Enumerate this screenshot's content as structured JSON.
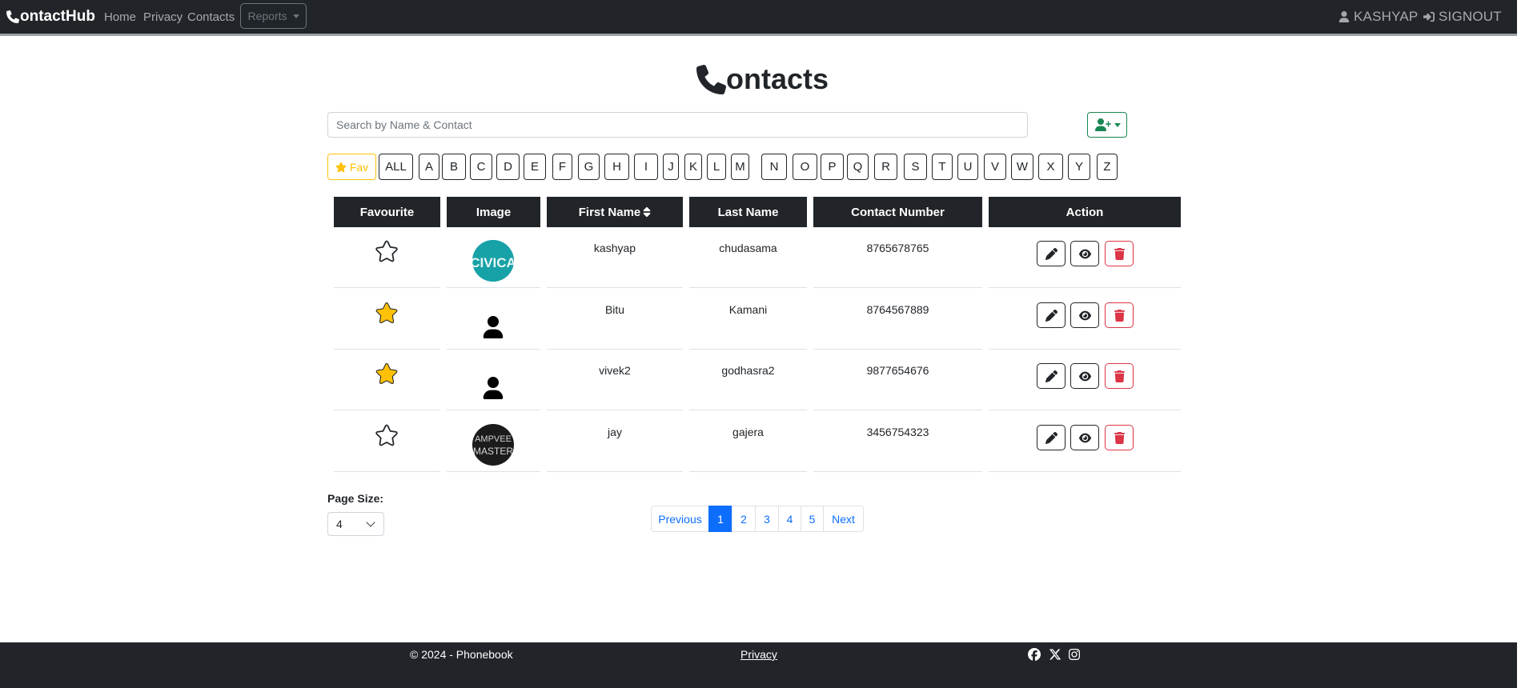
{
  "navbar": {
    "brand": "ontactHub",
    "links": [
      "Home",
      "Privacy",
      "Contacts"
    ],
    "reports": "Reports",
    "user": "KASHYAP",
    "signout": "SIGNOUT"
  },
  "title": "ontacts",
  "search": {
    "placeholder": "Search by Name & Contact"
  },
  "filter": {
    "fav": "Fav",
    "all": "ALL",
    "letters": [
      "A",
      "B",
      "C",
      "D",
      "E",
      "F",
      "G",
      "H",
      "I",
      "J",
      "K",
      "L",
      "M",
      "N",
      "O",
      "P",
      "Q",
      "R",
      "S",
      "T",
      "U",
      "V",
      "W",
      "X",
      "Y",
      "Z"
    ]
  },
  "table": {
    "headers": [
      "Favourite",
      "Image",
      "First Name",
      "Last Name",
      "Contact Number",
      "Action"
    ],
    "rows": [
      {
        "favourite": false,
        "image": "civica-logo",
        "first": "kashyap",
        "last": "chudasama",
        "phone": "8765678765"
      },
      {
        "favourite": true,
        "image": "person-icon",
        "first": "Bitu",
        "last": "Kamani",
        "phone": "8764567889"
      },
      {
        "favourite": true,
        "image": "person-icon",
        "first": "vivek2",
        "last": "godhasra2",
        "phone": "9877654676"
      },
      {
        "favourite": false,
        "image": "dark-photo",
        "first": "jay",
        "last": "gajera",
        "phone": "3456754323"
      }
    ]
  },
  "avatar_texts": {
    "civica": "CIVICA",
    "dark_top": "AMPVEE",
    "dark_bottom": "MASTER"
  },
  "pagesize": {
    "label": "Page Size:",
    "value": "4"
  },
  "pagination": {
    "previous": "Previous",
    "pages": [
      "1",
      "2",
      "3",
      "4",
      "5"
    ],
    "next": "Next",
    "active": "1"
  },
  "footer": {
    "copyright": "© 2024 - Phonebook",
    "privacy": "Privacy",
    "social": [
      "facebook-icon",
      "x-icon",
      "instagram-icon"
    ]
  },
  "colors": {
    "dark": "#212529",
    "star": "#ffc107",
    "primary": "#0d6efd",
    "danger": "#dc3545",
    "success": "#198754"
  }
}
